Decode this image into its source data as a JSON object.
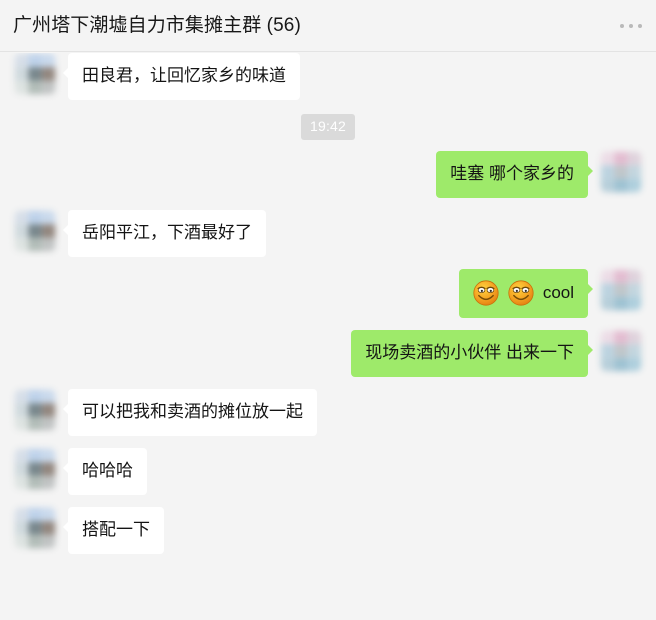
{
  "header": {
    "title": "广州塔下潮墟自力市集摊主群 (56)",
    "more_icon": "more-options-icon"
  },
  "colors": {
    "background": "#f4f4f4",
    "outgoing_bubble": "#9eea6a",
    "incoming_bubble": "#ffffff",
    "text": "#141414",
    "timestamp_pill": "#dadada",
    "timestamp_text": "#ffffff",
    "header_divider": "#e3e3e3"
  },
  "conversation": {
    "messages": [
      {
        "id": "m1",
        "side": "in",
        "type": "text",
        "text": "田良君，让回忆家乡的味道",
        "avatar": "blurred-contact-avatar"
      },
      {
        "id": "t1",
        "side": "center",
        "type": "timestamp",
        "text": "19:42"
      },
      {
        "id": "m2",
        "side": "out",
        "type": "text",
        "text": "哇塞 哪个家乡的",
        "avatar": "blurred-self-avatar"
      },
      {
        "id": "m3",
        "side": "in",
        "type": "text",
        "text": "岳阳平江，下酒最好了",
        "avatar": "blurred-contact-avatar"
      },
      {
        "id": "m4",
        "side": "out",
        "type": "emoji",
        "emoji_count": 2,
        "emoji_name": "wechat-grin-emoji",
        "text": "cool",
        "avatar": "blurred-self-avatar"
      },
      {
        "id": "m5",
        "side": "out",
        "type": "text",
        "text": "现场卖酒的小伙伴 出来一下",
        "avatar": "blurred-self-avatar"
      },
      {
        "id": "m6",
        "side": "in",
        "type": "text",
        "text": "可以把我和卖酒的摊位放一起",
        "avatar": "blurred-contact-avatar"
      },
      {
        "id": "m7",
        "side": "in",
        "type": "text",
        "text": "哈哈哈",
        "avatar": "blurred-contact-avatar"
      },
      {
        "id": "m8",
        "side": "in",
        "type": "text",
        "text": "搭配一下",
        "avatar": "blurred-contact-avatar"
      }
    ]
  }
}
